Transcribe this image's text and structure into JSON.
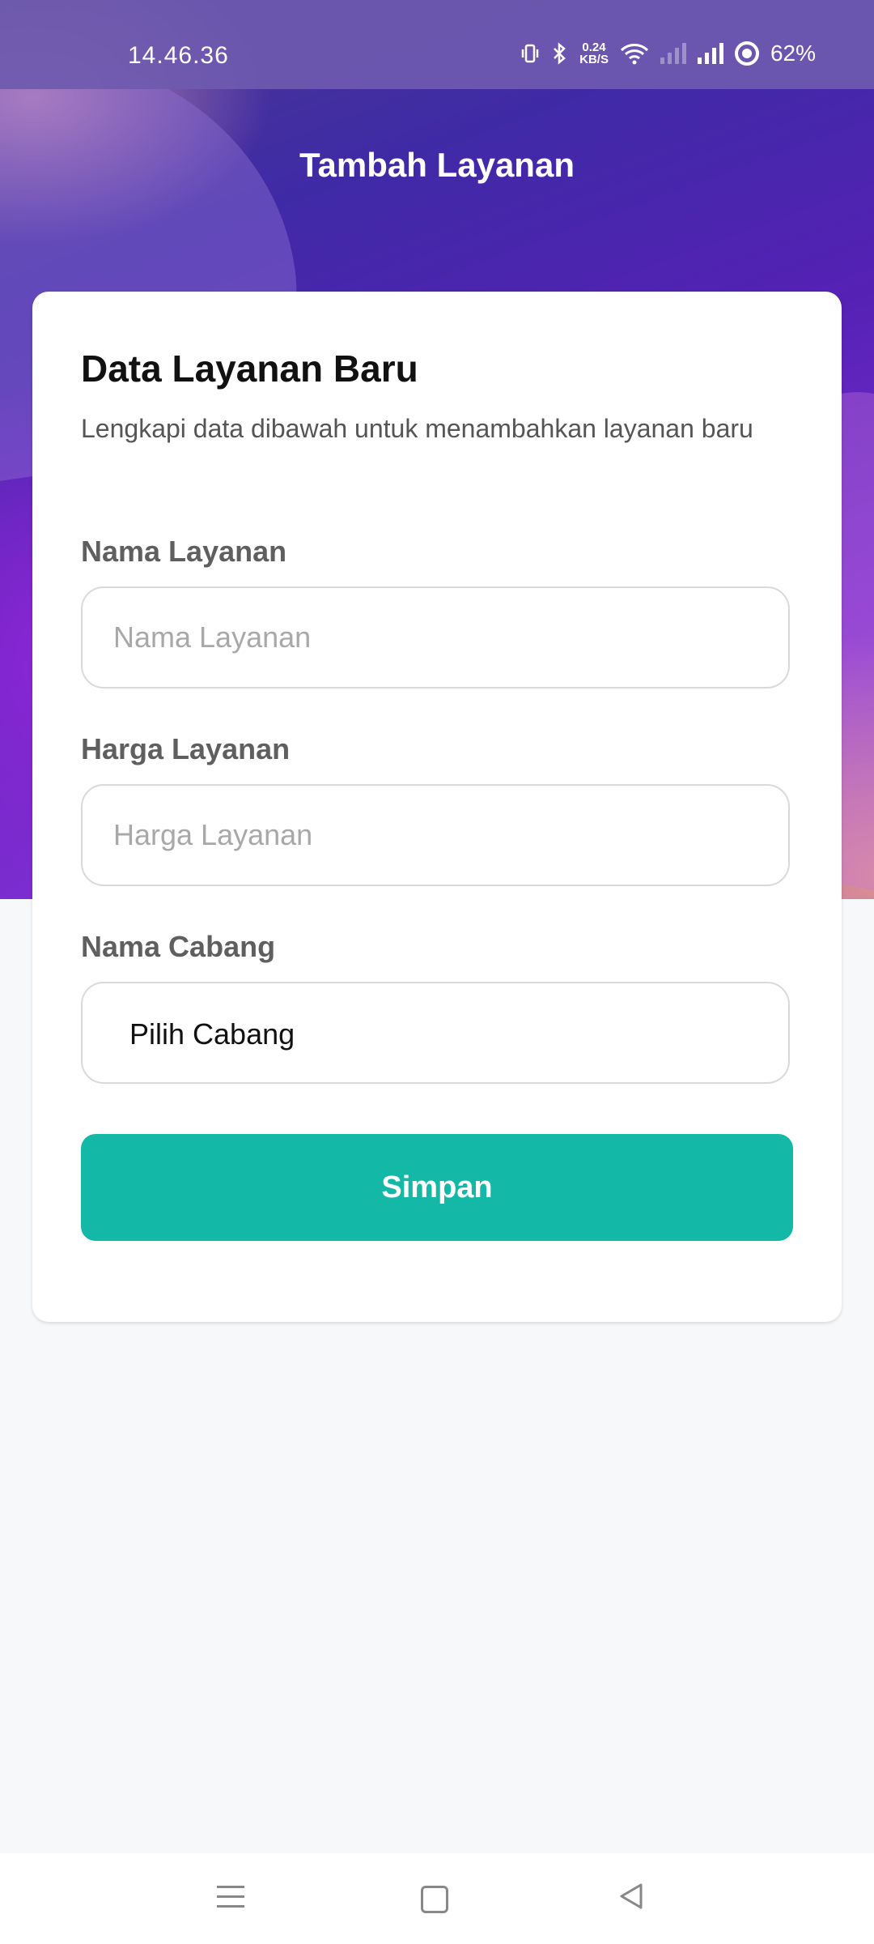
{
  "status_bar": {
    "time": "14.46.36",
    "net_speed_value": "0.24",
    "net_speed_unit": "KB/S",
    "battery": "62%",
    "icons": [
      "vibrate-icon",
      "bluetooth-icon",
      "wifi-icon",
      "signal-icon",
      "battery-icon"
    ]
  },
  "header": {
    "title": "Tambah Layanan"
  },
  "form": {
    "title": "Data Layanan Baru",
    "subtitle": "Lengkapi data dibawah untuk menambahkan layanan baru",
    "service_name": {
      "label": "Nama Layanan",
      "placeholder": "Nama Layanan",
      "value": ""
    },
    "service_price": {
      "label": "Harga Layanan",
      "placeholder": "Harga Layanan",
      "value": ""
    },
    "branch": {
      "label": "Nama Cabang",
      "selected": "Pilih Cabang"
    },
    "submit_label": "Simpan"
  },
  "colors": {
    "accent": "#14b8a6",
    "header_purple": "#5521b5",
    "background": "#f7f8fa"
  },
  "nav": {
    "icons": [
      "menu-icon",
      "home-icon",
      "back-icon"
    ]
  }
}
